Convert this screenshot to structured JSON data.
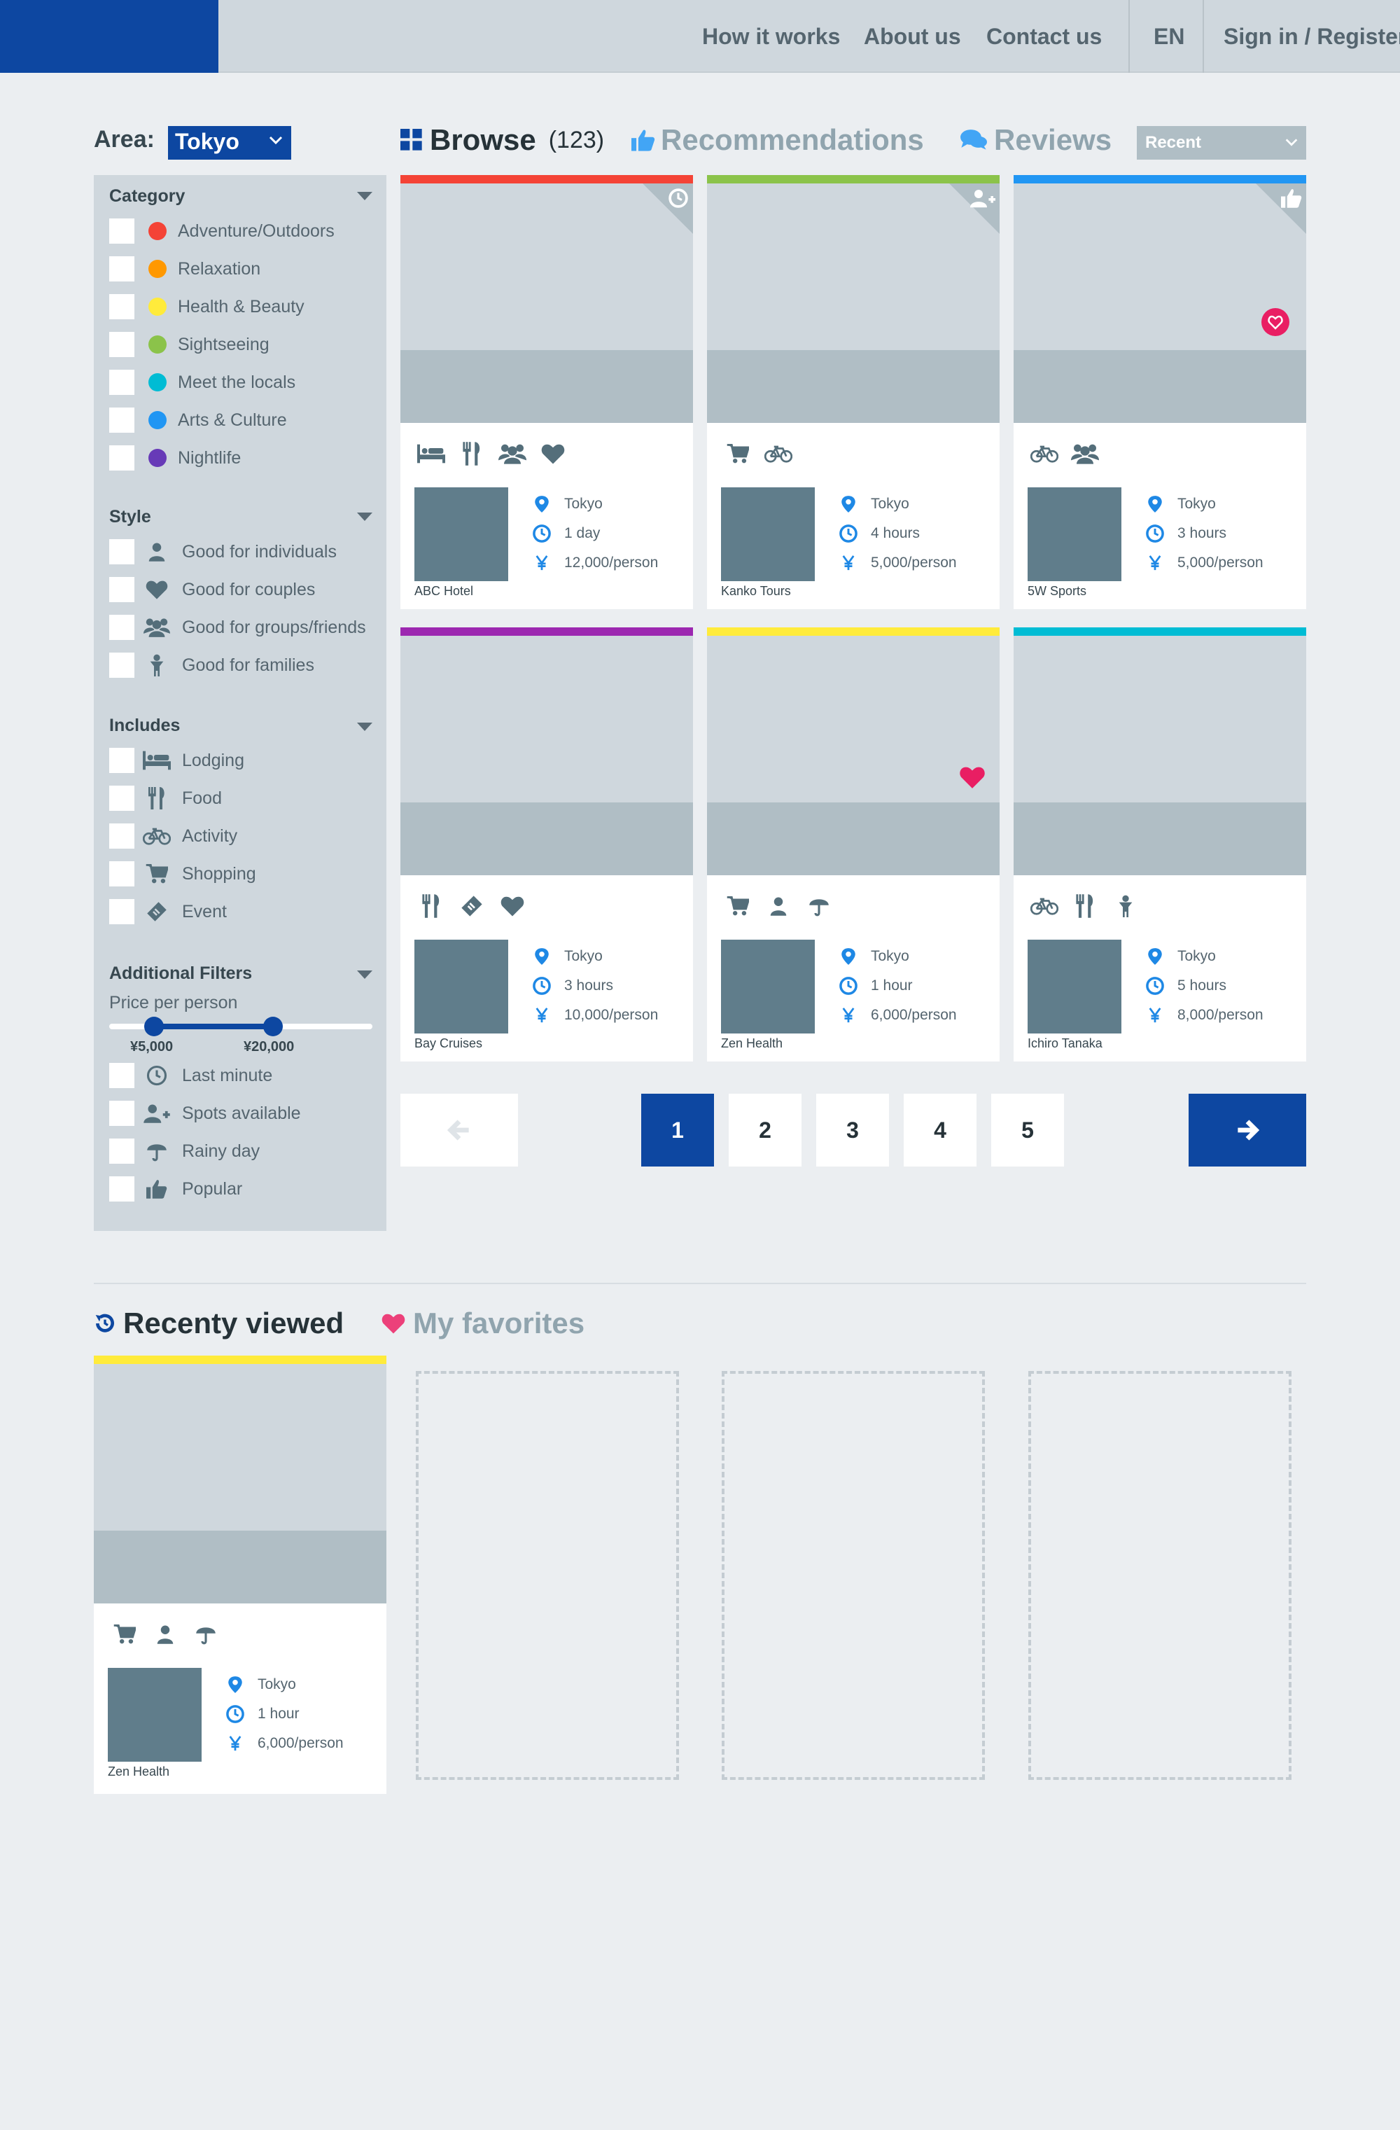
{
  "header": {
    "nav": [
      "How it works",
      "About us",
      "Contact us"
    ],
    "language": "EN",
    "signin": "Sign in / Register"
  },
  "filters": {
    "area_label": "Area:",
    "area_value": "Tokyo",
    "category": {
      "title": "Category",
      "items": [
        {
          "label": "Adventure/Outdoors",
          "color": "#f44336"
        },
        {
          "label": "Relaxation",
          "color": "#ff9800"
        },
        {
          "label": "Health & Beauty",
          "color": "#ffeb3b"
        },
        {
          "label": "Sightseeing",
          "color": "#8bc34a"
        },
        {
          "label": "Meet the locals",
          "color": "#00bcd4"
        },
        {
          "label": "Arts & Culture",
          "color": "#2196f3"
        },
        {
          "label": "Nightlife",
          "color": "#673ab7"
        }
      ]
    },
    "style": {
      "title": "Style",
      "items": [
        {
          "label": "Good for individuals",
          "icon": "person-icon"
        },
        {
          "label": "Good for couples",
          "icon": "heart-icon"
        },
        {
          "label": "Good for groups/friends",
          "icon": "group-icon"
        },
        {
          "label": "Good for families",
          "icon": "child-icon"
        }
      ]
    },
    "includes": {
      "title": "Includes",
      "items": [
        {
          "label": "Lodging",
          "icon": "bed-icon"
        },
        {
          "label": "Food",
          "icon": "utensils-icon"
        },
        {
          "label": "Activity",
          "icon": "bicycle-icon"
        },
        {
          "label": "Shopping",
          "icon": "cart-icon"
        },
        {
          "label": "Event",
          "icon": "ticket-icon"
        }
      ]
    },
    "additional": {
      "title": "Additional Filters",
      "price_label": "Price per person",
      "price_min": "¥5,000",
      "price_max": "¥20,000",
      "items": [
        {
          "label": "Last minute",
          "icon": "clock-icon"
        },
        {
          "label": "Spots available",
          "icon": "user-plus-icon"
        },
        {
          "label": "Rainy day",
          "icon": "umbrella-icon"
        },
        {
          "label": "Popular",
          "icon": "thumbs-up-icon"
        }
      ]
    }
  },
  "tabs": {
    "browse": "Browse",
    "browse_count": "(123)",
    "recommendations": "Recommendations",
    "reviews": "Reviews",
    "sort": "Recent"
  },
  "cards": [
    {
      "stripe": "#f44336",
      "corner": "clock-icon",
      "favorite": false,
      "icons": [
        "bed-icon",
        "utensils-icon",
        "group-icon",
        "heart-icon"
      ],
      "location": "Tokyo",
      "duration": "1 day",
      "price": "12,000/person",
      "vendor": "ABC Hotel"
    },
    {
      "stripe": "#8bc34a",
      "corner": "user-plus-icon",
      "favorite": false,
      "icons": [
        "cart-icon",
        "bicycle-icon"
      ],
      "location": "Tokyo",
      "duration": "4 hours",
      "price": "5,000/person",
      "vendor": "Kanko Tours"
    },
    {
      "stripe": "#2196f3",
      "corner": "thumbs-up-icon",
      "favorite": "outline",
      "icons": [
        "bicycle-icon",
        "group-icon"
      ],
      "location": "Tokyo",
      "duration": "3 hours",
      "price": "5,000/person",
      "vendor": "5W Sports"
    },
    {
      "stripe": "#9c27b0",
      "corner": null,
      "favorite": false,
      "icons": [
        "utensils-icon",
        "ticket-icon",
        "heart-icon"
      ],
      "location": "Tokyo",
      "duration": "3 hours",
      "price": "10,000/person",
      "vendor": "Bay Cruises"
    },
    {
      "stripe": "#ffeb3b",
      "corner": null,
      "favorite": "solid",
      "icons": [
        "cart-icon",
        "person-icon",
        "umbrella-icon"
      ],
      "location": "Tokyo",
      "duration": "1 hour",
      "price": "6,000/person",
      "vendor": "Zen Health"
    },
    {
      "stripe": "#00bcd4",
      "corner": null,
      "favorite": false,
      "icons": [
        "bicycle-icon",
        "utensils-icon",
        "child-icon"
      ],
      "location": "Tokyo",
      "duration": "5 hours",
      "price": "8,000/person",
      "vendor": "Ichiro Tanaka"
    }
  ],
  "pagination": {
    "pages": [
      "1",
      "2",
      "3",
      "4",
      "5"
    ],
    "current": "1"
  },
  "bottom": {
    "recent_title": "Recenty viewed",
    "favorites_title": "My favorites",
    "recent_card": {
      "stripe": "#ffeb3b",
      "icons": [
        "cart-icon",
        "person-icon",
        "umbrella-icon"
      ],
      "location": "Tokyo",
      "duration": "1 hour",
      "price": "6,000/person",
      "vendor": "Zen Health"
    }
  },
  "colors": {
    "primary": "#0d47a1",
    "accent_blue": "#1e88e5",
    "favorite_pink": "#e91e63",
    "panel": "#cfd7dd",
    "icon_gray": "#546e7a"
  }
}
